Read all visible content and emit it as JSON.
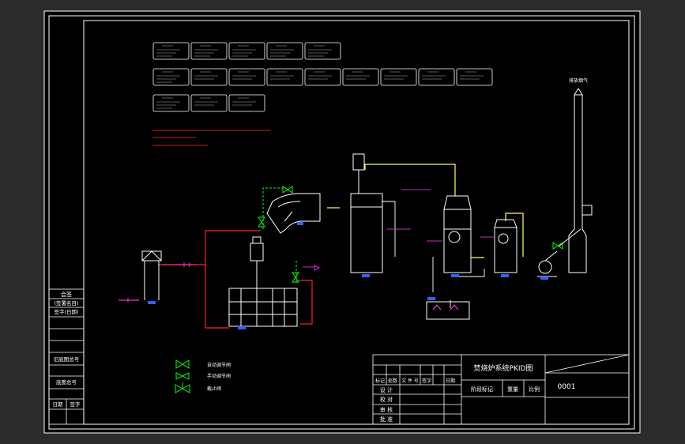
{
  "title_block": {
    "drawing_name": "焚烧炉系统PKID图",
    "drawing_number": "0001",
    "row_labels": [
      "设 计",
      "校 对",
      "审 核",
      "批 准"
    ],
    "header_cells": [
      "标记",
      "处数",
      "文 件 号",
      "签字",
      "日期"
    ],
    "stage_label": "阶段标记",
    "weight_label": "重量",
    "scale_label": "比例"
  },
  "left_strip": {
    "labels": [
      "会签",
      "(签署名目)",
      "签字(日期)",
      "旧底图总号",
      "底图总号",
      "日期",
      "签字"
    ]
  },
  "legend": {
    "items": [
      "自动调节阀",
      "手动调节阀",
      "截止阀"
    ]
  },
  "chimney_label": "排放烟气",
  "colors": {
    "frame": "#ffffff",
    "pipe_red": "#ff2020",
    "pipe_green": "#00ff00",
    "pipe_yellow": "#ffff60",
    "instrument": "#ff40ff",
    "tag_blue": "#3060ff",
    "equipment": "#ffffff"
  }
}
